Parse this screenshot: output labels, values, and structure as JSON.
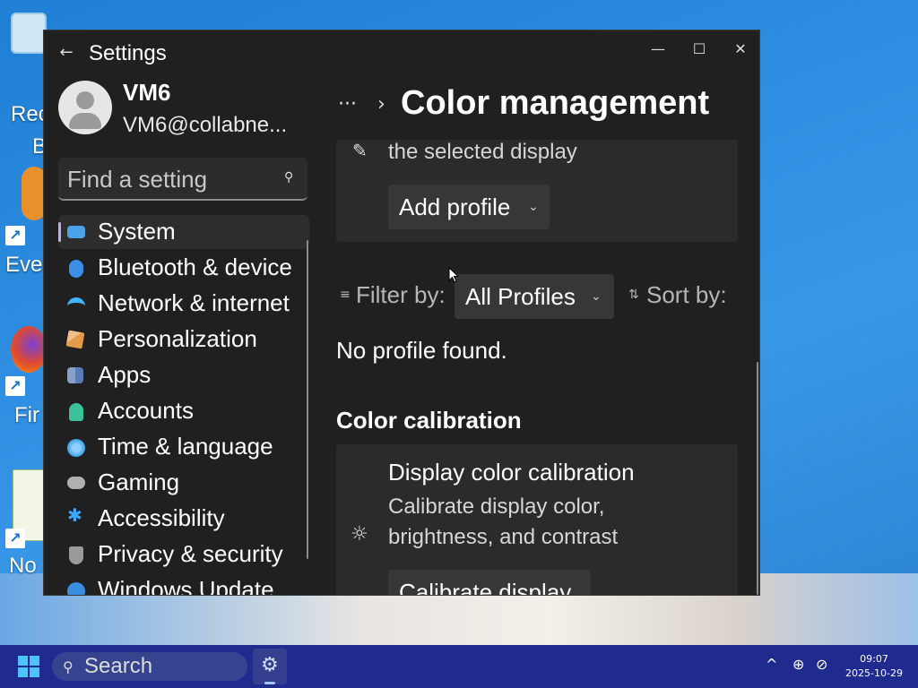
{
  "desktop": {
    "icons": [
      {
        "label": "Rec",
        "label2": "B"
      },
      {
        "label": "Ever"
      },
      {
        "label": "Fir"
      },
      {
        "label": "No"
      }
    ]
  },
  "window": {
    "title": "Settings",
    "controls": {
      "minimize": "—",
      "maximize": "☐",
      "close": "✕"
    }
  },
  "user": {
    "name": "VM6",
    "email": "VM6@collabne..."
  },
  "search": {
    "placeholder": "Find a setting"
  },
  "nav": {
    "items": [
      {
        "label": "System",
        "selected": true,
        "color": "#4aa3e8"
      },
      {
        "label": "Bluetooth & devices",
        "color": "#3b8fe8"
      },
      {
        "label": "Network & internet",
        "color": "#3fb6ff"
      },
      {
        "label": "Personalization",
        "color": "#e39a4a"
      },
      {
        "label": "Apps",
        "color": "#8aa0c8"
      },
      {
        "label": "Accounts",
        "color": "#3cc29a"
      },
      {
        "label": "Time & language",
        "color": "#3aa0e0"
      },
      {
        "label": "Gaming",
        "color": "#b0b0b0"
      },
      {
        "label": "Accessibility",
        "color": "#3fa8ff"
      },
      {
        "label": "Privacy & security",
        "color": "#9a9a9a"
      },
      {
        "label": "Windows Update",
        "color": "#3a8ee0"
      }
    ]
  },
  "breadcrumb": {
    "more": "···",
    "separator": "›",
    "title": "Color management"
  },
  "profiles_card": {
    "desc": "the selected display",
    "add_profile": "Add profile"
  },
  "filter": {
    "filter_by": "Filter by:",
    "filter_value": "All Profiles",
    "sort_by": "Sort by:"
  },
  "empty_state": "No profile found.",
  "calibration": {
    "section_title": "Color calibration",
    "item_title": "Display color calibration",
    "item_desc_1": "Calibrate display color,",
    "item_desc_2": "brightness, and contrast",
    "button": "Calibrate display"
  },
  "taskbar": {
    "search_label": "Search",
    "time": "09:07",
    "date": "2025-10-29"
  }
}
